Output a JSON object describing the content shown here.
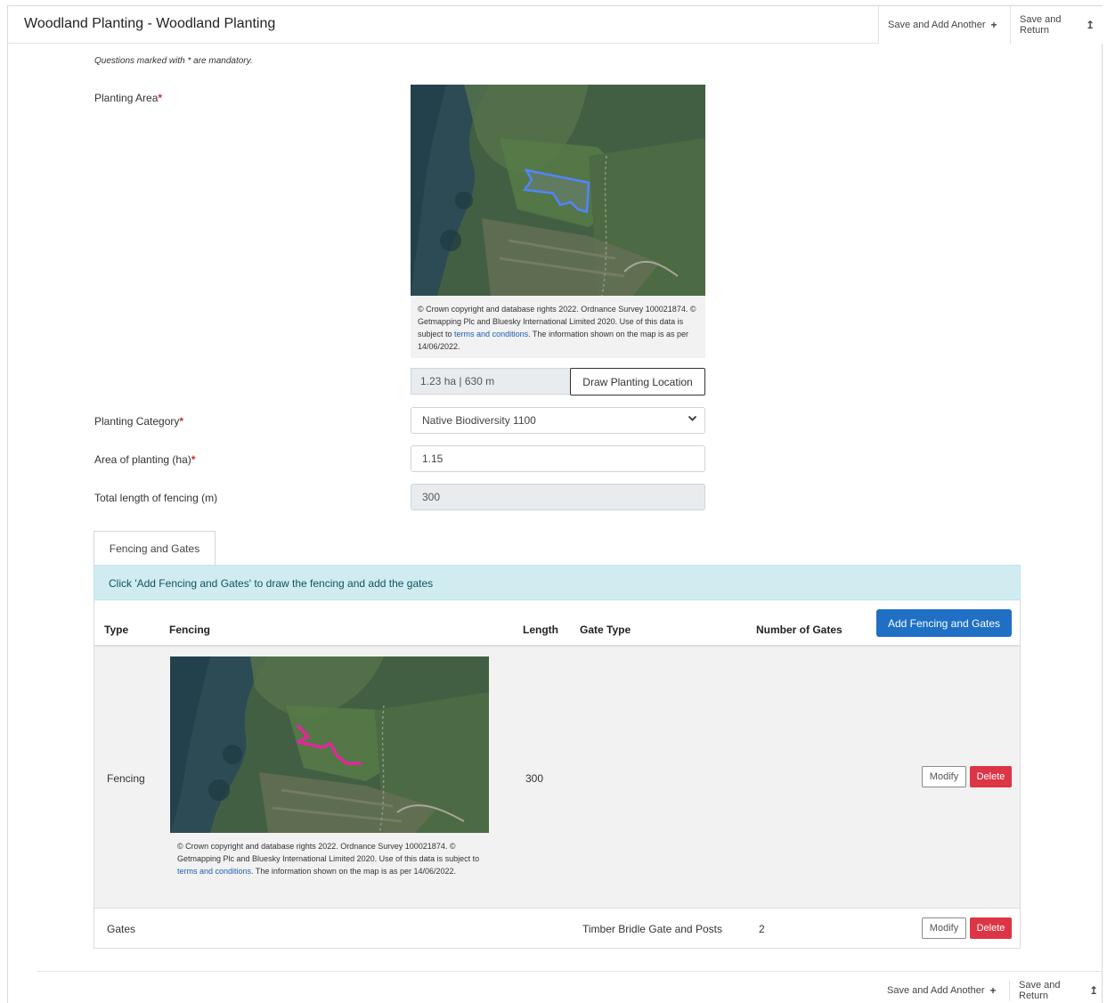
{
  "header": {
    "title": "Woodland Planting - Woodland Planting",
    "save_add_another": "Save and Add Another",
    "save_return": "Save and Return",
    "plus_glyph": "+",
    "return_glyph": "↥"
  },
  "form": {
    "mandatory_note": "Questions marked with * are mandatory.",
    "required_marker": "*",
    "planting_area_label": "Planting Area",
    "map_caption_prefix": "© Crown copyright and database rights 2022. Ordnance Survey 100021874. © Getmapping Plc and Bluesky International Limited 2020. Use of this data is subject to",
    "map_caption_link": "terms and conditions",
    "map_caption_suffix": ". The information shown on the map is as per 14/06/2022.",
    "area_readout": "1.23 ha | 630 m",
    "draw_button": "Draw Planting Location",
    "planting_category_label": "Planting Category",
    "planting_category_value": "Native Biodiversity 1100",
    "area_of_planting_label": "Area of planting (ha)",
    "area_of_planting_value": "1.15",
    "fencing_length_label": "Total length of fencing (m)",
    "fencing_length_value": "300"
  },
  "fencing": {
    "tab_label": "Fencing and Gates",
    "info_banner": "Click 'Add Fencing and Gates' to draw the fencing and add the gates",
    "columns": [
      "Type",
      "Fencing",
      "Length",
      "Gate Type",
      "Number of Gates"
    ],
    "add_button": "Add Fencing and Gates",
    "rows": [
      {
        "type": "Fencing",
        "length": "300",
        "caption_prefix": "© Crown copyright and database rights 2022. Ordnance Survey 100021874. © Getmapping Plc and Bluesky International Limited 2020. Use of this data is subject to",
        "caption_link": "terms and conditions",
        "caption_suffix": ". The information shown on the map is as per 14/06/2022.",
        "modify": "Modify",
        "delete": "Delete"
      },
      {
        "type": "Gates",
        "gate_type": "Timber Bridle Gate and Posts",
        "number_of_gates": "2",
        "modify": "Modify",
        "delete": "Delete"
      }
    ]
  },
  "footer": {
    "save_add_another": "Save and Add Another",
    "save_return": "Save and Return",
    "plus_glyph": "+",
    "return_glyph": "↥"
  },
  "icons": {
    "dropdown": "chevron-down-icon",
    "plus": "plus-icon",
    "return": "return-icon"
  },
  "colors": {
    "polygon_outline": "#4f86ff",
    "fencing_line": "#e0289a",
    "primary_button": "#1f6fc5",
    "delete_button": "#dc3545",
    "info_banner": "#d1ecf1"
  }
}
